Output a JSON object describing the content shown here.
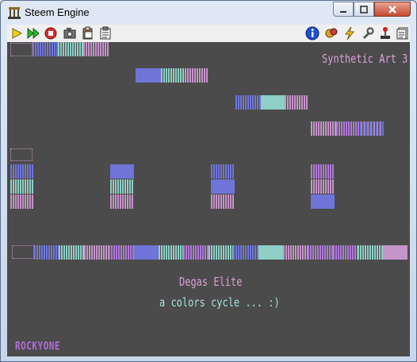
{
  "window": {
    "title": "Steem Engine"
  },
  "toolbar": {
    "left_icons": [
      "play-icon",
      "fast-forward-icon",
      "reset-icon",
      "snapshot-icon",
      "paste-icon",
      "clipboard-icon"
    ],
    "right_icons": [
      "info-icon",
      "patches-icon",
      "lightning-icon",
      "joystick-icon",
      "options-icon"
    ]
  },
  "screen": {
    "texts": {
      "synthetic_art": "Synthetic Art 3",
      "degas": "Degas Elite",
      "cycle": "a colors cycle ... :)",
      "signature": "ROCKYONE"
    }
  },
  "colors": {
    "screen_bg": "#4b4b4b",
    "blue": "#6f74d8",
    "teal": "#8fcfc6",
    "pink": "#c694c9",
    "purple": "#b07ad8"
  }
}
